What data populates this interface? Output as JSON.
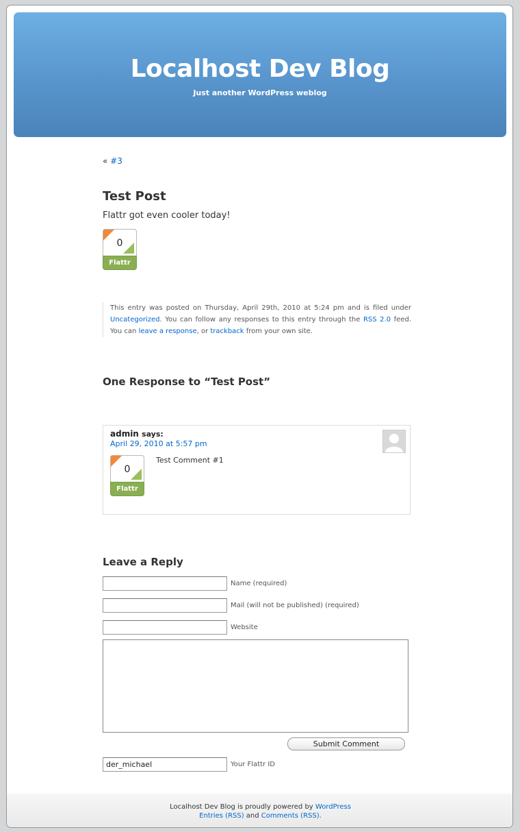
{
  "header": {
    "title": "Localhost Dev Blog",
    "description": "Just another WordPress weblog"
  },
  "nav": {
    "prev_marker": "«",
    "prev_link": "#3"
  },
  "post": {
    "title": "Test Post",
    "content": "Flattr got even cooler today!",
    "flattr": {
      "count": "0",
      "label": "Flattr"
    },
    "meta": {
      "t1": "This entry was posted on Thursday, April 29th, 2010 at 5:24 pm and is filed under ",
      "category": "Uncategorized",
      "t2": ". You can follow any responses to this entry through the ",
      "rss_link": "RSS 2.0",
      "t3": " feed. You can ",
      "leave_response_link": "leave a response",
      "t4": ", or ",
      "trackback_link": "trackback",
      "t5": " from your own site."
    }
  },
  "responses": {
    "title": "One Response to “Test Post”",
    "comments": [
      {
        "author": "admin",
        "says": "says:",
        "date": "April 29, 2010 at 5:57 pm",
        "text": "Test Comment #1",
        "flattr": {
          "count": "0",
          "label": "Flattr"
        }
      }
    ]
  },
  "reply": {
    "title": "Leave a Reply",
    "name_label": "Name (required)",
    "mail_label": "Mail (will not be published) (required)",
    "website_label": "Website",
    "submit_label": "Submit Comment",
    "flattr_id_value": "der_michael",
    "flattr_id_label": "Your Flattr ID"
  },
  "footer": {
    "t1": "Localhost Dev Blog is proudly powered by ",
    "wordpress_link": "WordPress",
    "entries_link": "Entries (RSS)",
    "and": " and ",
    "comments_link": "Comments (RSS)",
    "end": "."
  },
  "colors": {
    "header_top": "#6eb0e3",
    "header_bottom": "#4a83b9",
    "link": "#0066cc",
    "flattr_green": "#8aae52",
    "flattr_orange": "#f08a3a"
  }
}
